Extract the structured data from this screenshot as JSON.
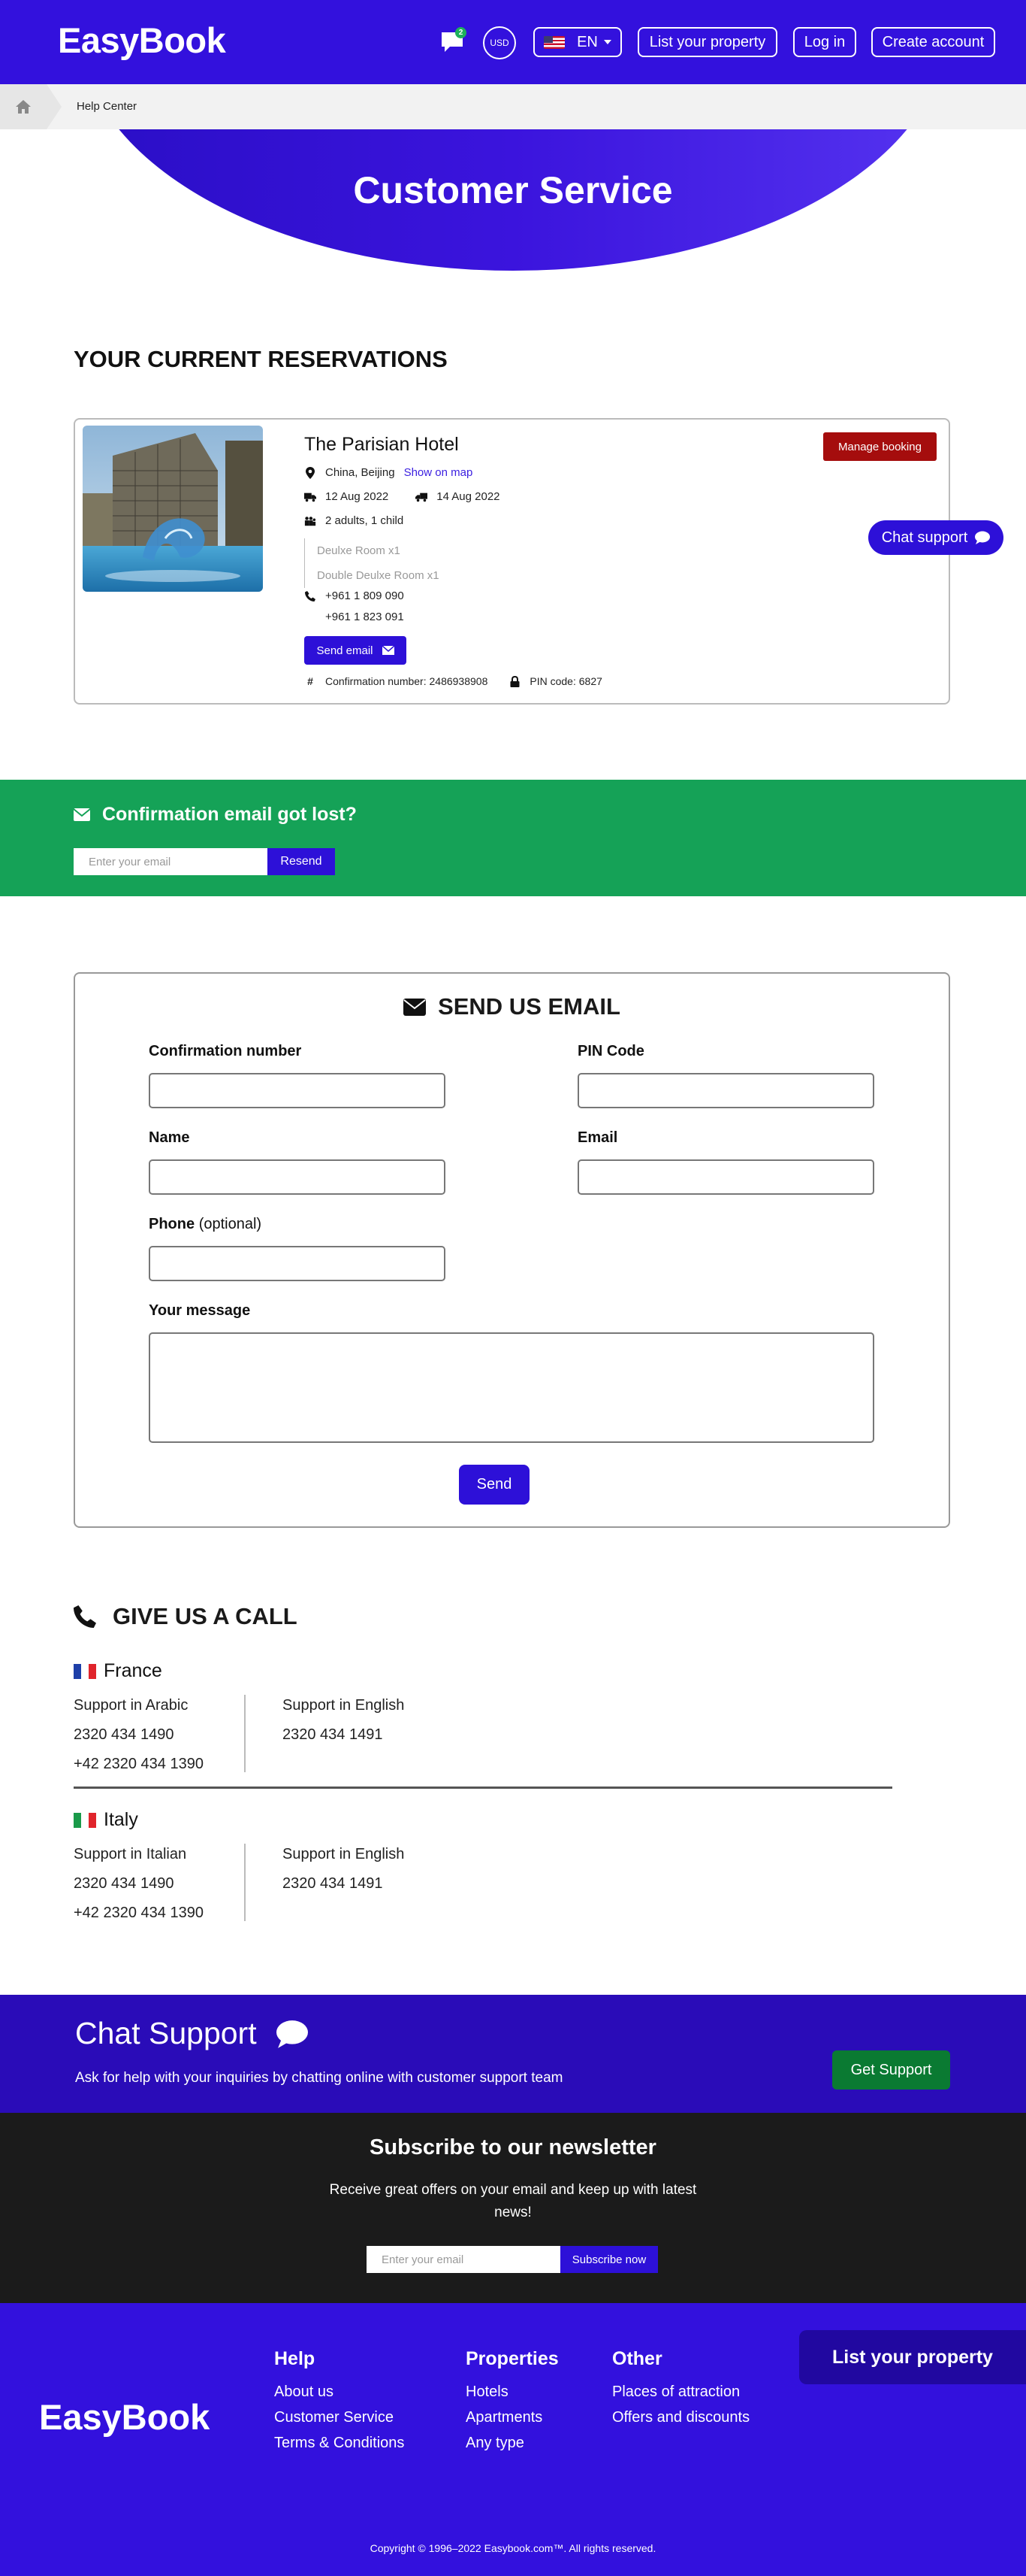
{
  "header": {
    "logo": "EasyBook",
    "chat_badge": "2",
    "currency": "USD",
    "language": "EN",
    "list_property": "List your property",
    "login": "Log in",
    "create_account": "Create account"
  },
  "breadcrumb": {
    "current": "Help Center"
  },
  "hero": {
    "title": "Customer Service"
  },
  "reservations": {
    "title": "YOUR CURRENT RESERVATIONS",
    "hotel_name": "The Parisian Hotel",
    "location": "China, Beijing",
    "show_on_map": "Show on map",
    "check_in": "12 Aug 2022",
    "check_out": "14 Aug 2022",
    "guests": "2 adults, 1 child",
    "rooms": [
      "Deulxe Room x1",
      "Double Deulxe Room x1"
    ],
    "phones": [
      "+961 1 809 090",
      "+961 1 823 091"
    ],
    "send_email": "Send email",
    "confirmation": "Confirmation number: 2486938908",
    "pin": "PIN code: 6827",
    "manage_booking": "Manage booking"
  },
  "chat_pill": "Chat support",
  "lost_email": {
    "title": "Confirmation email got lost?",
    "placeholder": "Enter your email",
    "button": "Resend"
  },
  "email_form": {
    "title": "SEND US EMAIL",
    "confirmation_label": "Confirmation number",
    "pin_label": "PIN Code",
    "name_label": "Name",
    "email_label": "Email",
    "phone_label": "Phone",
    "phone_optional": "(optional)",
    "message_label": "Your message",
    "send": "Send"
  },
  "call": {
    "title": "GIVE US A CALL",
    "countries": [
      {
        "name": "France",
        "left_title": "Support in Arabic",
        "left_numbers": [
          "2320 434 1490",
          "+42 2320 434 1390"
        ],
        "right_title": "Support in English",
        "right_numbers": [
          "2320 434 1491"
        ]
      },
      {
        "name": "Italy",
        "left_title": "Support in Italian",
        "left_numbers": [
          "2320 434 1490",
          "+42 2320 434 1390"
        ],
        "right_title": "Support in English",
        "right_numbers": [
          "2320 434 1491"
        ]
      }
    ]
  },
  "chat_band": {
    "title": "Chat Support",
    "subtitle": "Ask for help with your inquiries by chatting online with customer support team",
    "button": "Get Support"
  },
  "newsletter": {
    "title": "Subscribe to our newsletter",
    "subtitle": "Receive great offers on your email and keep up with latest news!",
    "placeholder": "Enter your email",
    "button": "Subscribe now"
  },
  "footer": {
    "logo": "EasyBook",
    "help": {
      "title": "Help",
      "links": [
        "About us",
        "Customer Service",
        "Terms & Conditions"
      ]
    },
    "properties": {
      "title": "Properties",
      "links": [
        "Hotels",
        "Apartments",
        "Any type"
      ]
    },
    "other": {
      "title": "Other",
      "links": [
        "Places of attraction",
        "Offers and discounts"
      ]
    },
    "list_property": "List your property",
    "copyright": "Copyright © 1996–2022 Easybook.com™. All rights reserved."
  },
  "colors": {
    "brand": "#3311dd",
    "green": "#15a257",
    "danger": "#a50d0d",
    "dark": "#1b1b1b"
  }
}
